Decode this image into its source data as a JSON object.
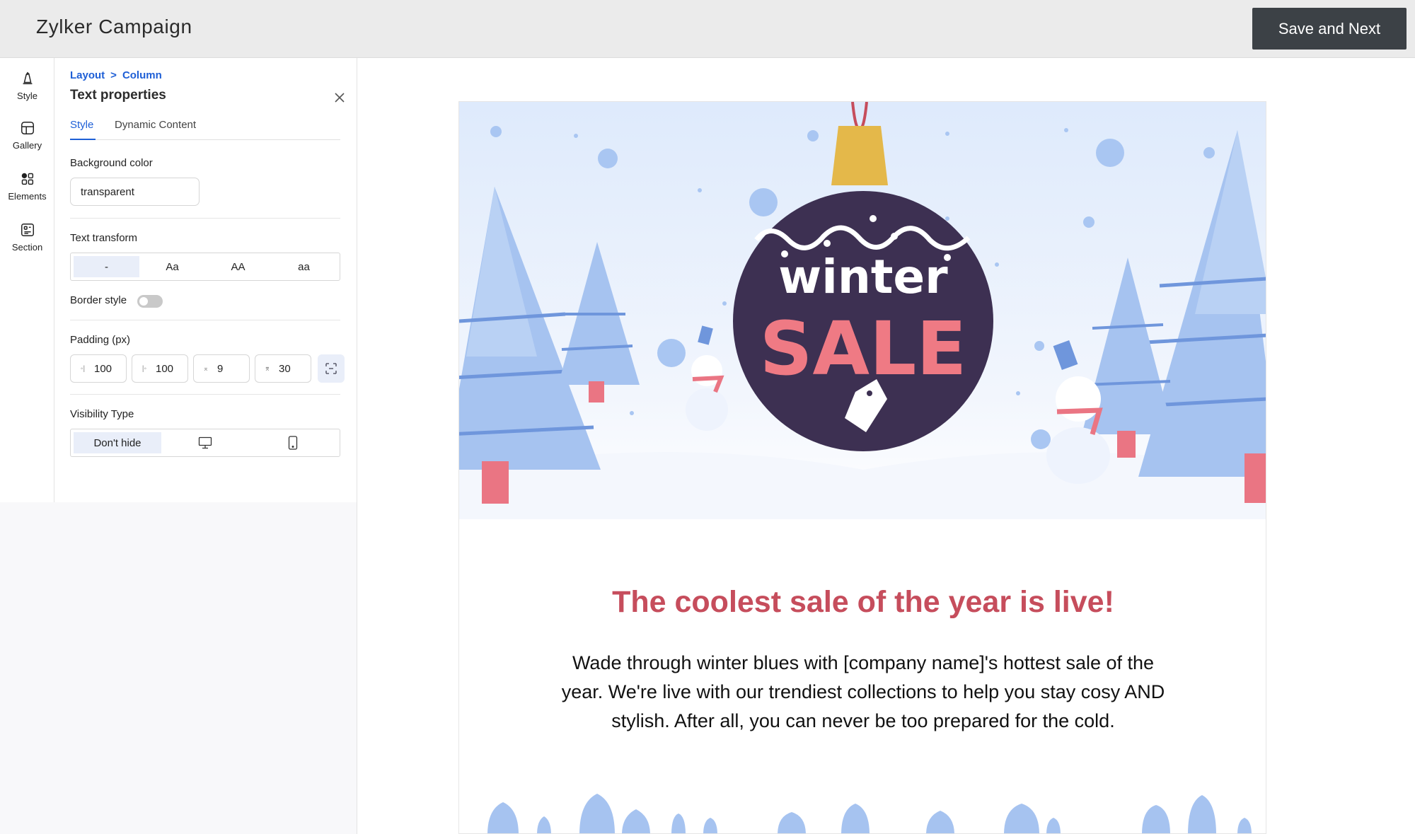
{
  "header": {
    "app_title": "Zylker Campaign",
    "save_label": "Save and Next"
  },
  "rail": {
    "items": [
      {
        "label": "Style",
        "icon": "style-icon"
      },
      {
        "label": "Gallery",
        "icon": "gallery-icon"
      },
      {
        "label": "Elements",
        "icon": "elements-icon"
      },
      {
        "label": "Section",
        "icon": "section-icon"
      }
    ]
  },
  "panel": {
    "breadcrumb": [
      "Layout",
      ">",
      "Column"
    ],
    "title": "Text properties",
    "tabs": [
      {
        "label": "Style",
        "active": true
      },
      {
        "label": "Dynamic Content",
        "active": false
      }
    ],
    "background_color": {
      "label": "Background color",
      "value": "transparent"
    },
    "text_transform": {
      "label": "Text transform",
      "options": [
        "-",
        "Aa",
        "AA",
        "aa"
      ],
      "selected": "-"
    },
    "border_style": {
      "label": "Border style",
      "enabled": false
    },
    "padding": {
      "label": "Padding (px)",
      "left": "100",
      "right": "100",
      "top": "9",
      "bottom": "30"
    },
    "visibility": {
      "label": "Visibility Type",
      "options": [
        "Don't hide",
        "desktop-icon",
        "mobile-icon"
      ],
      "selected": "Don't hide"
    }
  },
  "email": {
    "banner": {
      "line1": "winter",
      "line2": "SALE"
    },
    "headline": "The coolest sale of the year is live!",
    "body": "Wade through winter blues with [company name]'s hottest sale of the year. We're live with our trendiest collections to help you stay cosy AND stylish. After all, you can never be too prepared for the cold."
  },
  "colors": {
    "accent": "#1e5fd6",
    "headline": "#c64d5c",
    "ornament": "#3d3052",
    "sale_text": "#ef7a84",
    "snow_blue": "#a9c6f2",
    "save_button": "#3c4146"
  }
}
